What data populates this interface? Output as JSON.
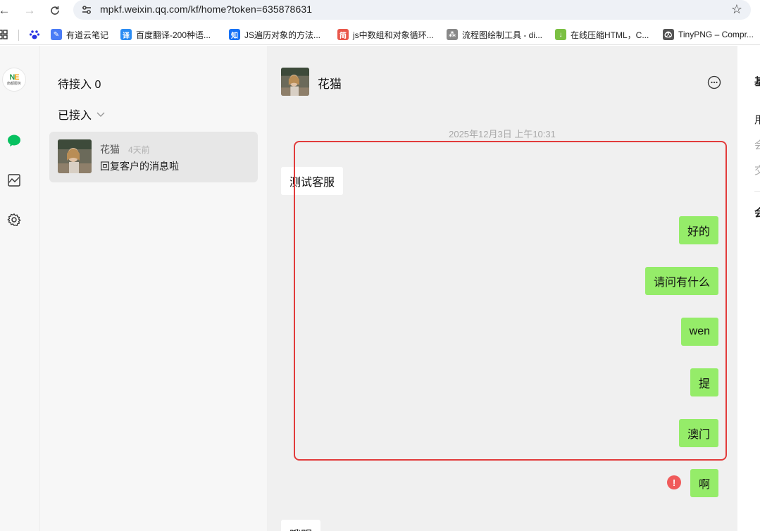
{
  "browser": {
    "url": "mpkf.weixin.qq.com/kf/home?token=635878631",
    "bookmarks": [
      {
        "label": "有道云笔记",
        "icon": "youdao-note-icon",
        "color": "#4a7cf6",
        "glyph": "✎"
      },
      {
        "label": "百度翻译-200种语...",
        "icon": "baidu-translate-icon",
        "color": "#2b8cf3",
        "glyph": "译"
      },
      {
        "label": "JS遍历对象的方法...",
        "icon": "zhihu-icon",
        "color": "#1772f6",
        "glyph": "知"
      },
      {
        "label": "js中数组和对象循环...",
        "icon": "jianshu-icon",
        "color": "#e9574b",
        "glyph": "简"
      },
      {
        "label": "流程图绘制工具 - di...",
        "icon": "diagram-tool-icon",
        "color": "#888888",
        "glyph": "⁂"
      },
      {
        "label": "在线压缩HTML，C...",
        "icon": "compress-tool-icon",
        "color": "#7bc043",
        "glyph": "↓"
      },
      {
        "label": "TinyPNG – Compr...",
        "icon": "tinypng-panda-icon",
        "color": "#555555",
        "glyph": "🐼"
      }
    ]
  },
  "logo": {
    "mark_a": "N",
    "mark_b": "E",
    "text": "南都服务"
  },
  "rail": {
    "icons": [
      "chat-bubble-icon",
      "chart-icon",
      "settings-gear-icon"
    ],
    "active_color": "#07c160"
  },
  "sessions": {
    "pending_label": "待接入 0",
    "accepted_label": "已接入",
    "items": [
      {
        "name": "花猫",
        "time": "4天前",
        "preview": "回复客户的消息啦"
      }
    ]
  },
  "chat": {
    "title": "花猫",
    "timestamp": "2025年12月3日 上午10:31",
    "messages": [
      {
        "direction": "in",
        "text": "测试客服"
      },
      {
        "direction": "out",
        "text": "好的"
      },
      {
        "direction": "out",
        "text": "请问有什么"
      },
      {
        "direction": "out",
        "text": "wen"
      },
      {
        "direction": "out",
        "text": "提"
      },
      {
        "direction": "out",
        "text": "澳门"
      },
      {
        "direction": "out",
        "text": "啊",
        "failed": true
      },
      {
        "direction": "in",
        "text": "哦明"
      }
    ],
    "failed_glyph": "!",
    "highlight_color": "#e23b3b"
  },
  "info_panel": {
    "fragments": [
      "基",
      "用",
      "会",
      "交",
      "会"
    ]
  }
}
